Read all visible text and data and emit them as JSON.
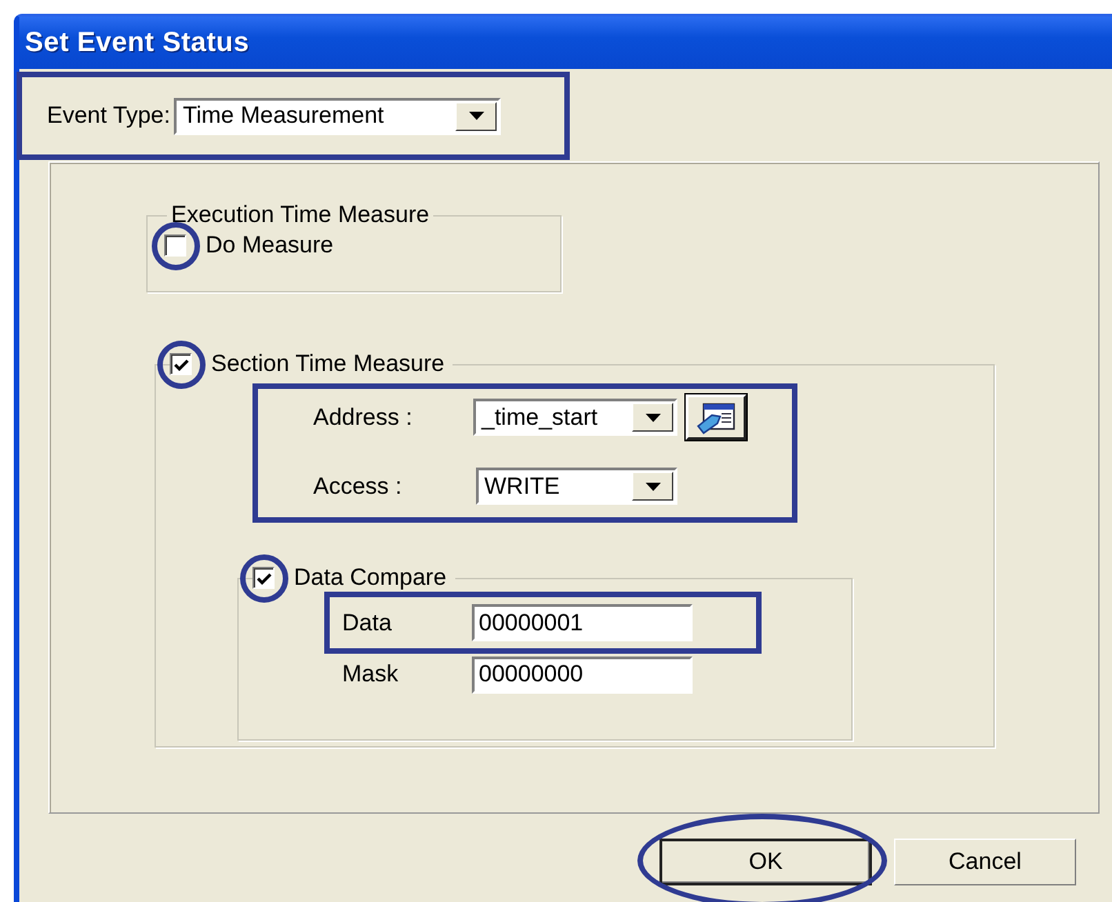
{
  "window": {
    "title": "Set Event Status"
  },
  "event_type": {
    "label": "Event Type:",
    "value": "Time Measurement",
    "highlighted": true
  },
  "execution_group": {
    "title": "Execution Time Measure",
    "checkbox": {
      "label": "Do Measure",
      "checked": false,
      "highlighted": true
    }
  },
  "section_group": {
    "checkbox": {
      "label": "Section Time Measure",
      "checked": true,
      "highlighted": true
    },
    "fields_highlighted": true,
    "address": {
      "label": "Address :",
      "value": "_time_start"
    },
    "access": {
      "label": "Access :",
      "value": "WRITE"
    },
    "data_compare": {
      "checkbox": {
        "label": "Data Compare",
        "checked": true,
        "highlighted": true
      },
      "fields": [
        {
          "label": "Data",
          "value": "00000001",
          "highlighted": true
        },
        {
          "label": "Mask",
          "value": "00000000",
          "highlighted": false
        }
      ]
    }
  },
  "buttons": [
    {
      "label": "OK",
      "default": true,
      "highlighted": true
    },
    {
      "label": "Cancel",
      "default": false,
      "highlighted": false
    }
  ]
}
